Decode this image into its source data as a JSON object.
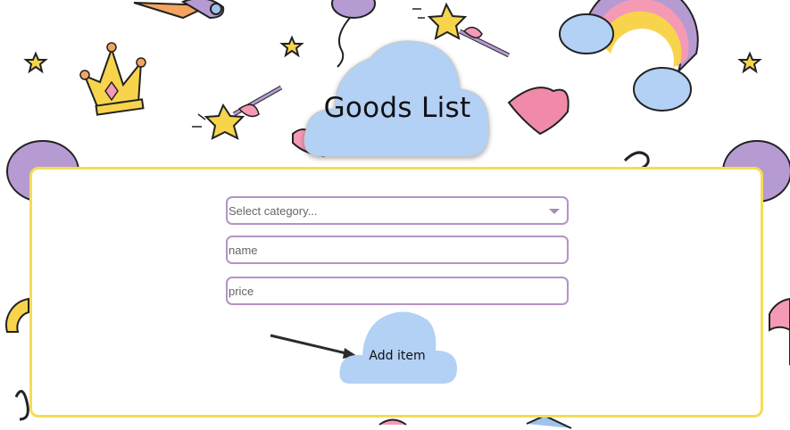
{
  "page": {
    "title": "Goods List"
  },
  "form": {
    "category": {
      "placeholder": "Select category..."
    },
    "name": {
      "placeholder": "name"
    },
    "price": {
      "placeholder": "price"
    },
    "add_label": "Add item"
  },
  "colors": {
    "panel_border": "#f6dc55",
    "field_border": "#b693c4",
    "cloud": "#b3d0f5"
  },
  "icons": {
    "background": [
      "ice-cream-icon",
      "balloon-icon",
      "magic-wand-icon",
      "crown-icon",
      "star-icon",
      "rainbow-icon",
      "heart-icon"
    ],
    "select_caret": "chevron-down-icon"
  }
}
